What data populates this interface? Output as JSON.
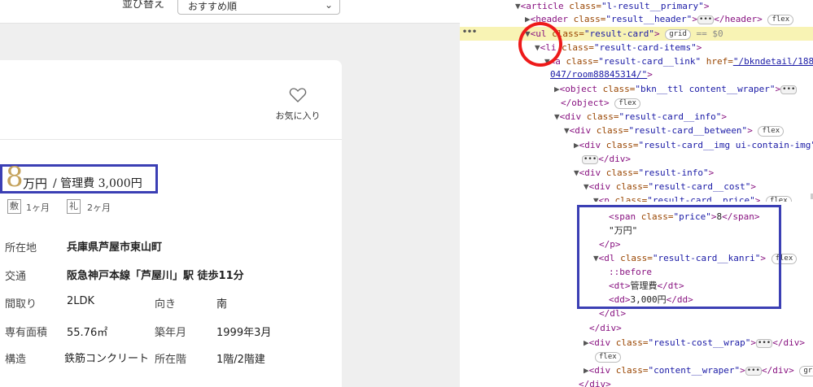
{
  "sort": {
    "label": "並び替え",
    "value": "おすすめ順"
  },
  "card": {
    "favorite_label": "お気に入り",
    "price": "8",
    "price_unit": "万円",
    "fee": "/ 管理費 3,000円",
    "deposit_tag": "敷",
    "deposit": "1ヶ月",
    "key_money_tag": "礼",
    "key_money": "2ヶ月",
    "details": [
      {
        "label": "所在地",
        "value": "兵庫県芦屋市東山町"
      },
      {
        "label": "交通",
        "value": "阪急神戸本線「芦屋川」駅 徒歩11分"
      },
      {
        "label": "間取り",
        "value": "2LDK",
        "label2": "向き",
        "value2": "南"
      },
      {
        "label": "専有面積",
        "value": "55.76㎡",
        "label2": "築年月",
        "value2": "1999年3月"
      },
      {
        "label": "構造",
        "value": "鉄筋コンクリート",
        "label2": "所在階",
        "value2": "1階/2階建"
      }
    ]
  },
  "devtools": {
    "lines": [
      {
        "tri": "▼",
        "tag": "<article",
        "attr": " class=",
        "val": "\"l-result__primary\"",
        "end": ">"
      },
      {
        "tri": "▶",
        "tag": "<header",
        "attr": " class=",
        "val": "\"result__header\"",
        "end": ">",
        "dots": "•••",
        "close": "</header>",
        "badge": "flex"
      },
      {
        "tri": "▼",
        "tag": "<ul",
        "attr": " class=",
        "val": "\"result-card\"",
        "end": ">",
        "badge": "grid",
        "extra": " == $0"
      },
      {
        "tri": "▼",
        "tag": "<li",
        "attr": " class=",
        "val": "\"result-card-items\"",
        "end": ">"
      },
      {
        "tri": "▼",
        "tag": "<a",
        "attr": " class=",
        "val": "\"result-card__link\"",
        "attr2": " href=",
        "link": "\"/bkndetail/1880465"
      },
      {
        "link": "047/room88845314/\"",
        "end": ">"
      },
      {
        "tri": "▶",
        "tag": "<object",
        "attr": " class=",
        "val": "\"bkn__ttl content__wraper\"",
        "end": ">",
        "dots": "•••"
      },
      {
        "tag": "</object>",
        "badge": "flex"
      },
      {
        "tri": "▼",
        "tag": "<div",
        "attr": " class=",
        "val": "\"result-card__info\"",
        "end": ">"
      },
      {
        "tri": "▼",
        "tag": "<div",
        "attr": " class=",
        "val": "\"result-card__between\"",
        "end": ">",
        "badge": "flex"
      },
      {
        "tri": "▶",
        "tag": "<div",
        "attr": " class=",
        "val": "\"result-card__img ui-contain-img\"",
        "end": ">"
      },
      {
        "dots": "•••",
        "close": "</div>"
      },
      {
        "tri": "▼",
        "tag": "<div",
        "attr": " class=",
        "val": "\"result-info\"",
        "end": ">"
      },
      {
        "tri": "▼",
        "tag": "<div",
        "attr": " class=",
        "val": "\"result-card__cost\"",
        "end": ">"
      },
      {
        "tri": "▼",
        "tag": "<p",
        "attr": " class=",
        "val": "\"result-card__price\"",
        "end": ">",
        "badge": "flex"
      },
      {
        "tag": "<span",
        "attr": " class=",
        "val": "\"price\"",
        "end": ">",
        "text": "8",
        "close": "</span>"
      },
      {
        "text": "\"万円\""
      },
      {
        "tag": "</p>"
      },
      {
        "tri": "▼",
        "tag": "<dl",
        "attr": " class=",
        "val": "\"result-card__kanri\"",
        "end": ">",
        "badge": "flex"
      },
      {
        "pseudo": "::before"
      },
      {
        "tag": "<dt>",
        "text": "管理費",
        "close": "</dt>"
      },
      {
        "tag": "<dd>",
        "text": "3,000円",
        "close": "</dd>"
      },
      {
        "tag": "</dl>"
      },
      {
        "tag": "</div>"
      },
      {
        "tri": "▶",
        "tag": "<div",
        "attr": " class=",
        "val": "\"result-cost__wrap\"",
        "end": ">",
        "dots": "•••",
        "close": "</div>"
      },
      {
        "badge": "flex"
      },
      {
        "tri": "▶",
        "tag": "<div",
        "attr": " class=",
        "val": "\"content__wraper\"",
        "end": ">",
        "dots": "•••",
        "close": "</div>",
        "badge": "grid"
      },
      {
        "tag": "</div>"
      }
    ]
  }
}
